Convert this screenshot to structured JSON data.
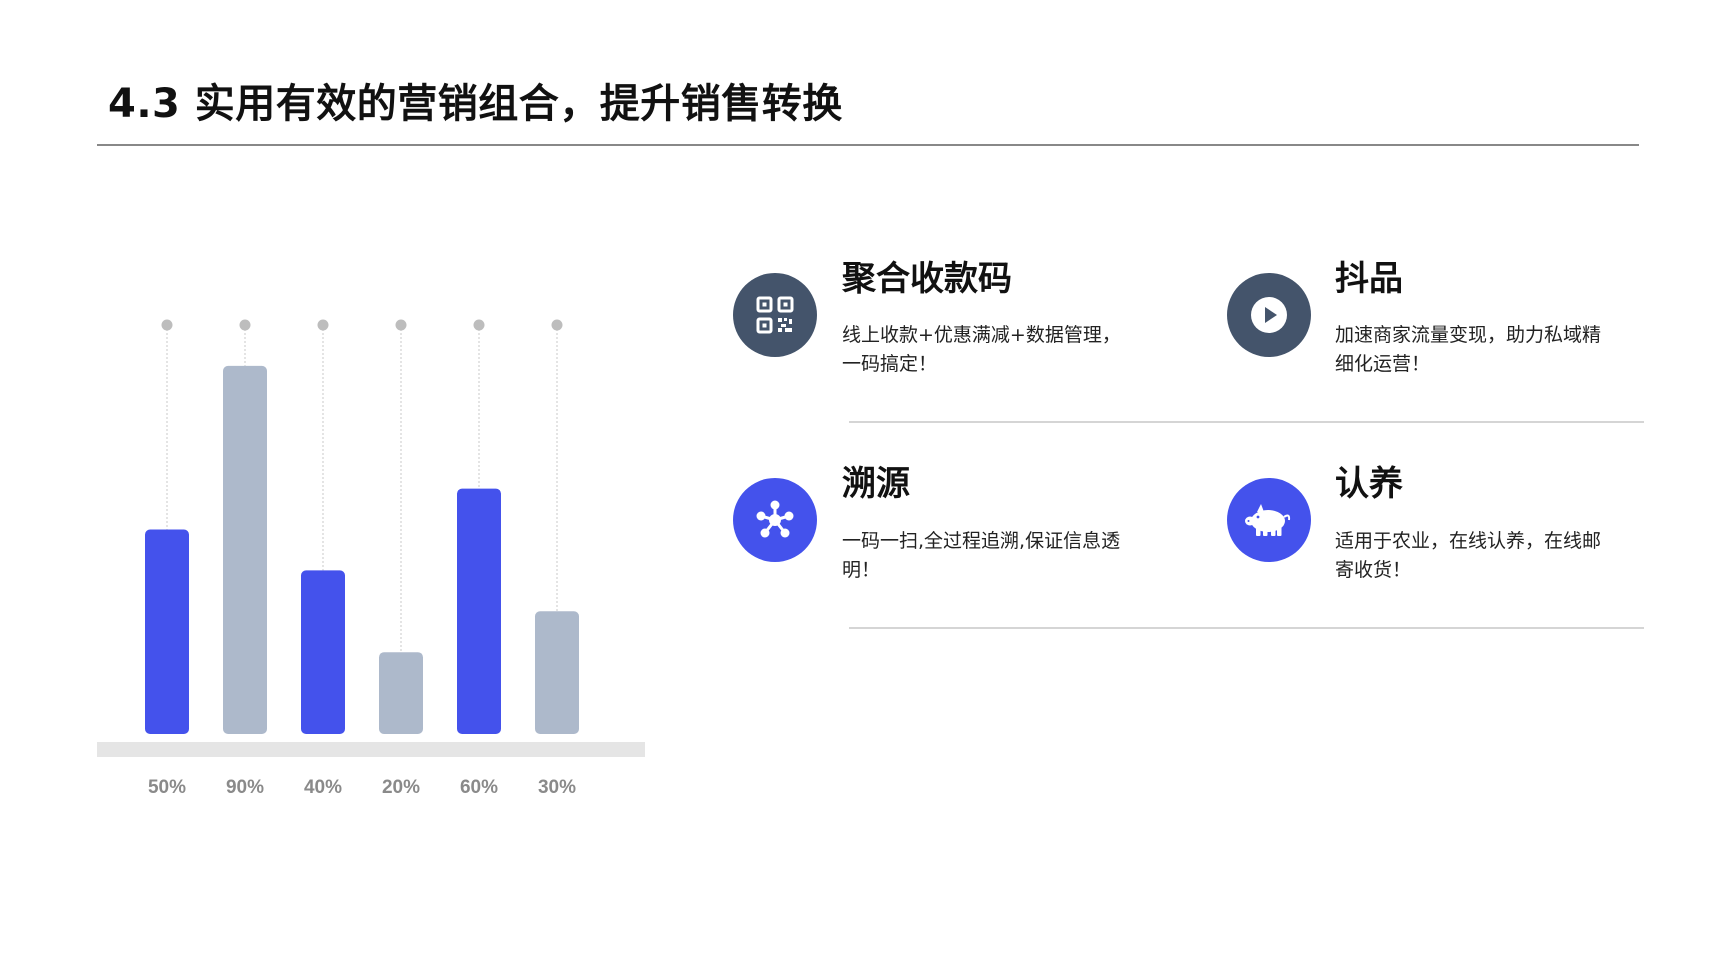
{
  "page": {
    "title": "4.3 实用有效的营销组合，提升销售转换"
  },
  "colors": {
    "primary": "#4452EC",
    "secondary": "#ADB9CB",
    "dark_icon": "#44546B",
    "baseline": "#E5E5E5",
    "tick_label": "#8A8A8A"
  },
  "chart_data": {
    "type": "bar",
    "categories": [
      "50%",
      "90%",
      "40%",
      "20%",
      "60%",
      "30%"
    ],
    "values": [
      50,
      90,
      40,
      20,
      60,
      30
    ],
    "bar_colors": [
      "#4452EC",
      "#ADB9CB",
      "#4452EC",
      "#ADB9CB",
      "#4452EC",
      "#ADB9CB"
    ],
    "ylim": [
      0,
      100
    ],
    "grid": false,
    "title": "",
    "xlabel": "",
    "ylabel": ""
  },
  "features": [
    {
      "title": "聚合收款码",
      "desc_line1": "线上收款+优惠满减+数据管理，",
      "desc_line2": "一码搞定！",
      "icon": "qr-code-icon",
      "icon_color": "#44546B"
    },
    {
      "title": "抖品",
      "desc_line1": "加速商家流量变现，助力私域精",
      "desc_line2": "细化运营！",
      "icon": "play-icon",
      "icon_color": "#44546B"
    },
    {
      "title": "溯源",
      "desc_line1": "一码一扫,全过程追溯,保证信息透",
      "desc_line2": "明！",
      "icon": "network-icon",
      "icon_color": "#4452EC"
    },
    {
      "title": "认养",
      "desc_line1": "适用于农业，在线认养，在线邮",
      "desc_line2": "寄收货！",
      "icon": "pig-icon",
      "icon_color": "#4452EC"
    }
  ]
}
